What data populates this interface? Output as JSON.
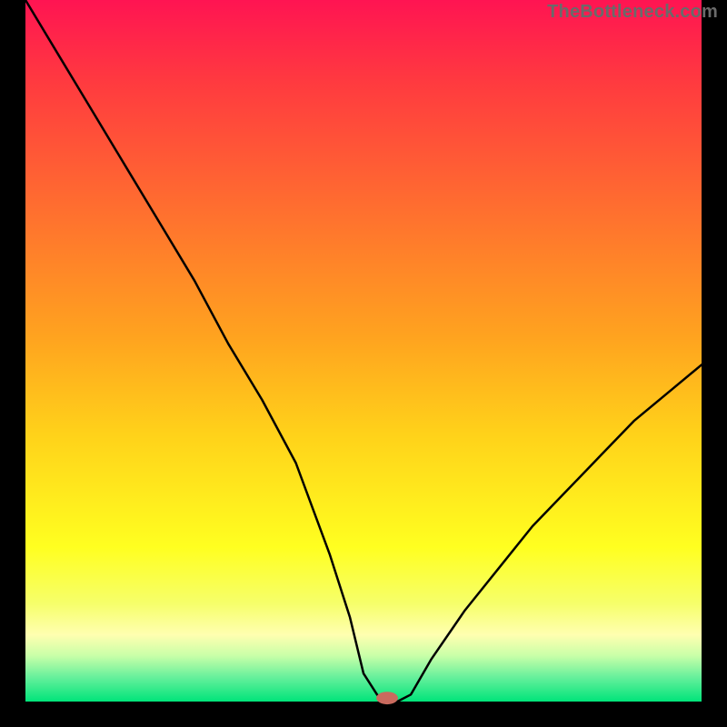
{
  "watermark": "TheBottleneck.com",
  "chart_data": {
    "type": "line",
    "title": "",
    "xlabel": "",
    "ylabel": "",
    "xlim": [
      0,
      100
    ],
    "ylim": [
      0,
      100
    ],
    "grid": false,
    "legend": false,
    "background_gradient": {
      "stops": [
        {
          "offset": 0.0,
          "color": "#ff1452"
        },
        {
          "offset": 0.12,
          "color": "#ff3b3f"
        },
        {
          "offset": 0.3,
          "color": "#ff6f2f"
        },
        {
          "offset": 0.48,
          "color": "#ffa31f"
        },
        {
          "offset": 0.62,
          "color": "#ffd21a"
        },
        {
          "offset": 0.78,
          "color": "#ffff20"
        },
        {
          "offset": 0.86,
          "color": "#f6ff6a"
        },
        {
          "offset": 0.905,
          "color": "#ffffb0"
        },
        {
          "offset": 0.935,
          "color": "#c8ffa8"
        },
        {
          "offset": 0.965,
          "color": "#68f09c"
        },
        {
          "offset": 1.0,
          "color": "#00e47a"
        }
      ]
    },
    "series": [
      {
        "name": "bottleneck-curve",
        "color": "#000000",
        "width": 2.5,
        "x": [
          0,
          5,
          10,
          15,
          20,
          25,
          30,
          35,
          40,
          45,
          48,
          50,
          52,
          53,
          55,
          57,
          60,
          65,
          70,
          75,
          80,
          85,
          90,
          95,
          100
        ],
        "values": [
          100,
          92,
          84,
          76,
          68,
          60,
          51,
          43,
          34,
          21,
          12,
          4,
          1,
          0,
          0,
          1,
          6,
          13,
          19,
          25,
          30,
          35,
          40,
          44,
          48
        ]
      }
    ],
    "marker": {
      "x": 53.5,
      "y": 0.5,
      "rx": 1.6,
      "ry": 0.9,
      "color": "#c96a5e"
    },
    "axes": {
      "left": {
        "x": 3.5,
        "color": "#000",
        "width": 6
      },
      "right": {
        "x": 96.5,
        "color": "#000",
        "width": 6
      },
      "bottom": {
        "y": 0,
        "color": "#000",
        "width": 6
      }
    }
  }
}
